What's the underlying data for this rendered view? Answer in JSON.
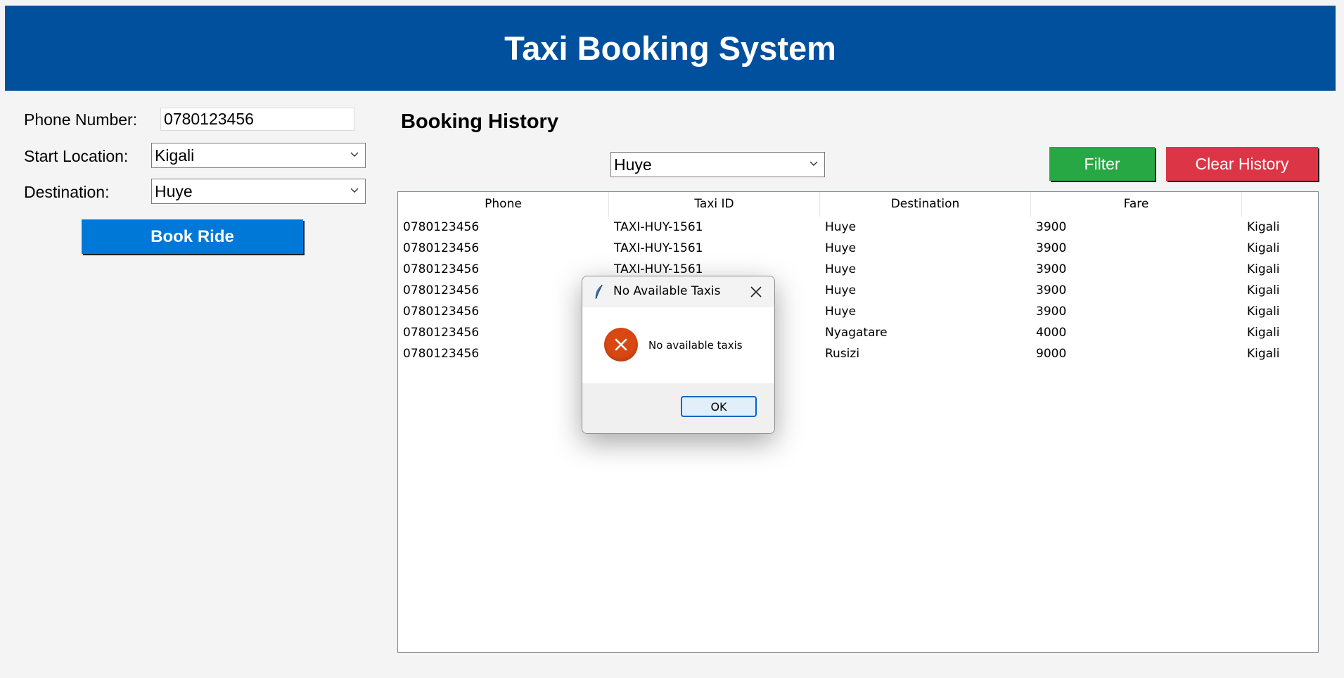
{
  "header": {
    "title": "Taxi Booking System"
  },
  "form": {
    "phone_label": "Phone Number:",
    "phone_value": "0780123456",
    "start_label": "Start Location:",
    "start_value": "Kigali",
    "destination_label": "Destination:",
    "destination_value": "Huye",
    "book_button": "Book Ride"
  },
  "history": {
    "title": "Booking History",
    "filter_value": "Huye",
    "filter_button": "Filter",
    "clear_button": "Clear History",
    "columns": [
      "Phone",
      "Taxi ID",
      "Destination",
      "Fare",
      ""
    ],
    "rows": [
      [
        "0780123456",
        "TAXI-HUY-1561",
        "Huye",
        "3900",
        "Kigali"
      ],
      [
        "0780123456",
        "TAXI-HUY-1561",
        "Huye",
        "3900",
        "Kigali"
      ],
      [
        "0780123456",
        "TAXI-HUY-1561",
        "Huye",
        "3900",
        "Kigali"
      ],
      [
        "0780123456",
        "",
        "Huye",
        "3900",
        "Kigali"
      ],
      [
        "0780123456",
        "",
        "Huye",
        "3900",
        "Kigali"
      ],
      [
        "0780123456",
        "",
        "Nyagatare",
        "4000",
        "Kigali"
      ],
      [
        "0780123456",
        "",
        "Rusizi",
        "9000",
        "Kigali"
      ]
    ]
  },
  "dialog": {
    "title": "No Available Taxis",
    "message": "No available taxis",
    "ok_button": "OK",
    "icons": {
      "app": "feather-icon",
      "close": "close-icon",
      "status": "error-icon"
    }
  },
  "colors": {
    "header_bg": "#00509e",
    "book_button": "#0078d7",
    "filter_button": "#28a745",
    "clear_button": "#dc3545",
    "error_icon": "#d94812"
  }
}
